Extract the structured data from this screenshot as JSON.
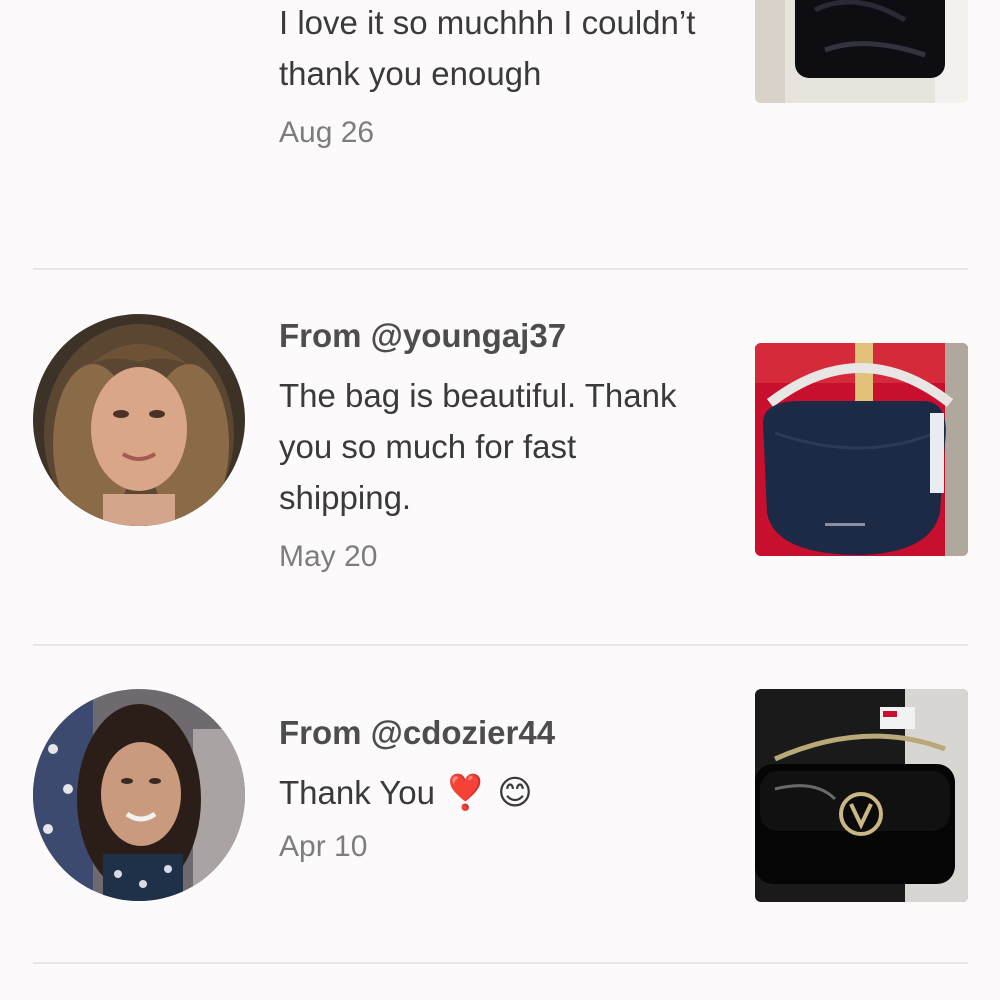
{
  "reviews": [
    {
      "from": "",
      "message": "I love it so muchhh I couldn’t thank you enough",
      "date": "Aug 26",
      "avatar_icon": "user-avatar-photo",
      "thumb_icon": "black-bag-photo"
    },
    {
      "from": "From @youngaj37",
      "message": "The bag is beautiful. Thank you so much for fast shipping.",
      "date": "May 20",
      "avatar_icon": "user-avatar-photo",
      "thumb_icon": "navy-hobo-bag-photo"
    },
    {
      "from": "From @cdozier44",
      "message": "Thank You",
      "message_emojis": "❣️ 😊",
      "date": "Apr 10",
      "avatar_icon": "user-avatar-photo",
      "thumb_icon": "black-patent-bag-photo"
    }
  ],
  "colors": {
    "background": "#fcfafb",
    "divider": "#e8e6e7",
    "from_text": "#4d4d4d",
    "date_text": "#7d7d7d"
  }
}
